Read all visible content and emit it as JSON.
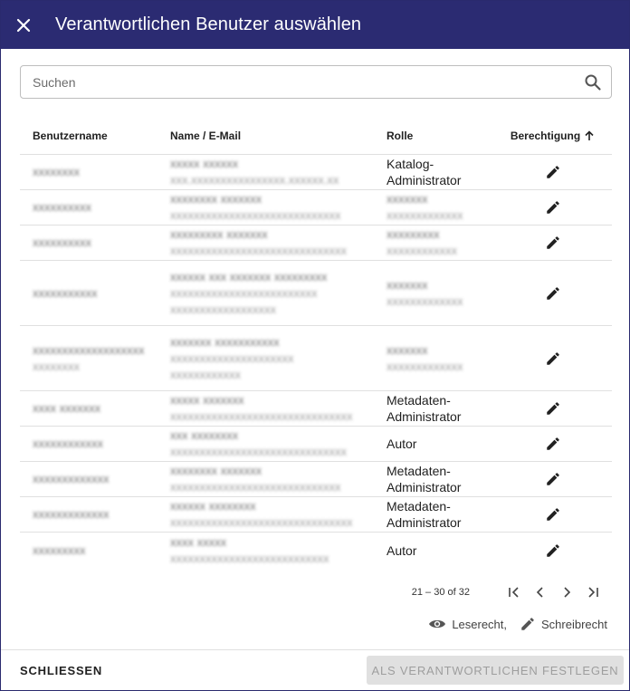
{
  "dialog": {
    "title": "Verantwortlichen Benutzer auswählen",
    "accent_color": "#2b2b72"
  },
  "search": {
    "placeholder": "Suchen",
    "value": ""
  },
  "table": {
    "headers": {
      "username": "Benutzername",
      "name_email": "Name / E-Mail",
      "role": "Rolle",
      "permission": "Berechtigung"
    },
    "rows": [
      {
        "username": "xxxxxxxx",
        "name": "xxxxx xxxxxx",
        "email": "xxx.xxxxxxxxxxxxxxxx.xxxxxx.xx",
        "role": "Katalog-Administrator"
      },
      {
        "username": "xxxxxxxxxx",
        "name": "xxxxxxxx xxxxxxx",
        "email": "xxxxxxxxxxxxxxxxxxxxxxxxxxxxx",
        "role": ""
      },
      {
        "username": "xxxxxxxxxx",
        "name": "xxxxxxxxx xxxxxxx",
        "email": "xxxxxxxxxxxxxxxxxxxxxxxxxxxxxx",
        "role": ""
      },
      {
        "username": "xxxxxxxxxxx",
        "name": "xxxxxx xxx xxxxxxx xxxxxxxxx",
        "email": "xxxxxxxxxxxxxxxxxxxxxxxxx",
        "role": ""
      },
      {
        "username": "xxxxxxxxxxxxxxxxxxx",
        "name": "xxxxxxx xxxxxxxxxxx",
        "email": "xxxxxxxxxxxxxxxxxxxxx",
        "role": ""
      },
      {
        "username": "xxxx xxxxxxx",
        "name": "xxxxx xxxxxxx",
        "email": "xxxxxxxxxxxxxxxxxxxxxxxxxxxxxxx",
        "role": "Metadaten-Administrator"
      },
      {
        "username": "xxxxxxxxxxxx",
        "name": "xxx xxxxxxxx",
        "email": "xxxxxxxxxxxxxxxxxxxxxxxxxxxxxx",
        "role": "Autor"
      },
      {
        "username": "xxxxxxxxxxxxx",
        "name": "xxxxxxxx xxxxxxx",
        "email": "xxxxxxxxxxxxxxxxxxxxxxxxxxxxx",
        "role": "Metadaten-Administrator"
      },
      {
        "username": "xxxxxxxxxxxxx",
        "name": "xxxxxx xxxxxxxx",
        "email": "xxxxxxxxxxxxxxxxxxxxxxxxxxxxxxx",
        "role": "Metadaten-Administrator"
      },
      {
        "username": "xxxxxxxxx",
        "name": "xxxx xxxxx",
        "email": "xxxxxxxxxxxxxxxxxxxxxxxxxxx",
        "role": "Autor"
      }
    ]
  },
  "paginator": {
    "range_label": "21 – 30 of 32"
  },
  "legend": {
    "read": "Leserecht,",
    "write": "Schreibrecht"
  },
  "footer": {
    "close_label": "SCHLIESSEN",
    "confirm_label": "ALS VERANTWORTLICHEN FESTLEGEN"
  }
}
